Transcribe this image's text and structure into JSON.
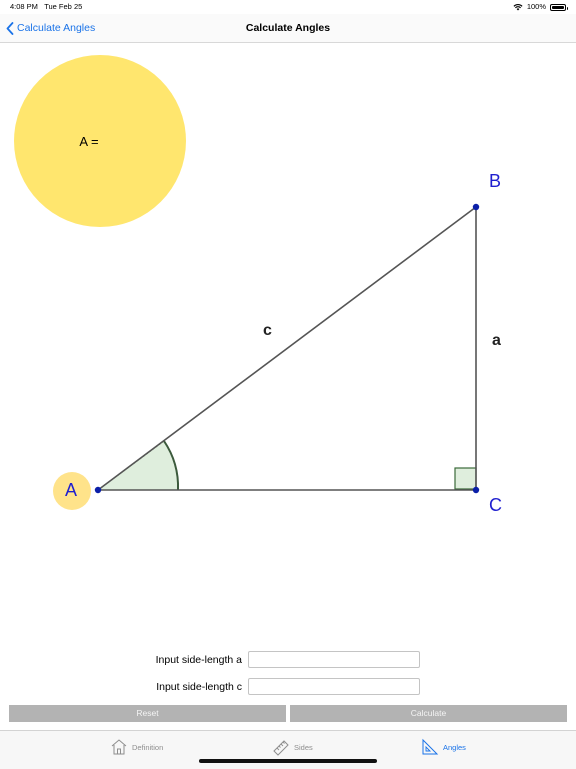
{
  "status_bar": {
    "time": "4:08 PM",
    "date": "Tue Feb 25",
    "battery": "100%"
  },
  "nav": {
    "back_label": "Calculate Angles",
    "title": "Calculate Angles"
  },
  "result": {
    "text": "A ="
  },
  "triangle": {
    "vertex_a": "A",
    "vertex_b": "B",
    "vertex_c": "C",
    "side_a": "a",
    "side_c": "c",
    "point_color": "#0b1fa8",
    "label_color": "#1f1fcf",
    "circle_color": "#ffe66e"
  },
  "form": {
    "label_a": "Input side-length a",
    "value_a": "",
    "label_c": "Input side-length c",
    "value_c": ""
  },
  "buttons": {
    "reset": "Reset",
    "calculate": "Calculate"
  },
  "tabs": [
    {
      "label": "Definition",
      "icon": "house-icon",
      "active": false
    },
    {
      "label": "Sides",
      "icon": "ruler-icon",
      "active": false
    },
    {
      "label": "Angles",
      "icon": "set-square-icon",
      "active": true
    }
  ],
  "accent_color": "#1a73e8"
}
